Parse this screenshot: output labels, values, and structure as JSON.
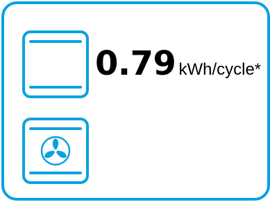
{
  "energy": {
    "value": "0.79",
    "unit": "kWh/cycle*"
  },
  "icons": {
    "conventional": "oven-icon",
    "fan_forced": "fan-oven-icon"
  },
  "colors": {
    "accent": "#0aa2de",
    "text": "#000000",
    "background": "#ffffff"
  }
}
